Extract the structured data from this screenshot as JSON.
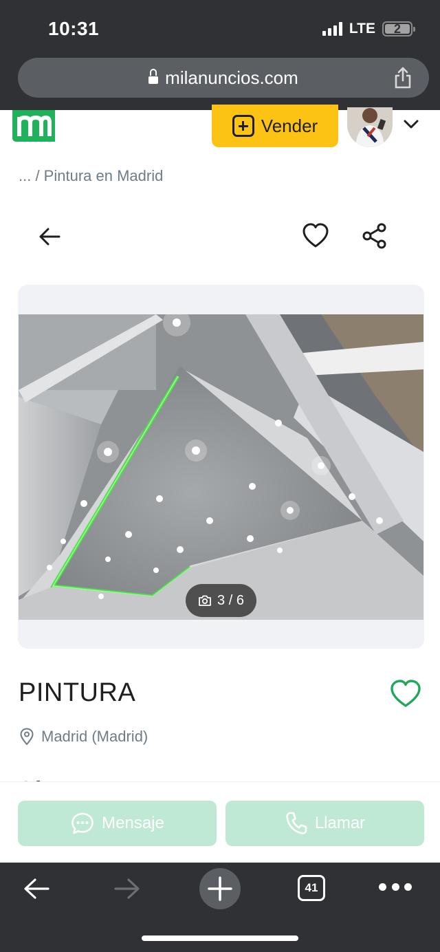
{
  "status_bar": {
    "time": "10:31",
    "network": "LTE",
    "battery": "2"
  },
  "browser": {
    "url": "milanuncios.com",
    "tab_count": "41"
  },
  "header": {
    "sell_label": "Vender",
    "brand_color": "#1fb25a",
    "sell_color": "#fcc314"
  },
  "breadcrumb": "... / Pintura en Madrid",
  "gallery": {
    "counter": "3 / 6",
    "current": 3,
    "total": 6
  },
  "ad": {
    "title": "PINTURA",
    "location": "Madrid (Madrid)",
    "section_peek": "Ofrezco"
  },
  "actions": {
    "message_label": "Mensaje",
    "call_label": "Llamar",
    "button_color": "#bfe9d4"
  },
  "icons": [
    "lock-icon",
    "share-icon",
    "plus-icon",
    "chevron-down-icon",
    "arrow-left-icon",
    "heart-icon",
    "share-nodes-icon",
    "camera-icon",
    "location-pin-icon",
    "chat-icon",
    "phone-icon",
    "arrow-right-icon",
    "tabs-icon",
    "more-icon"
  ]
}
